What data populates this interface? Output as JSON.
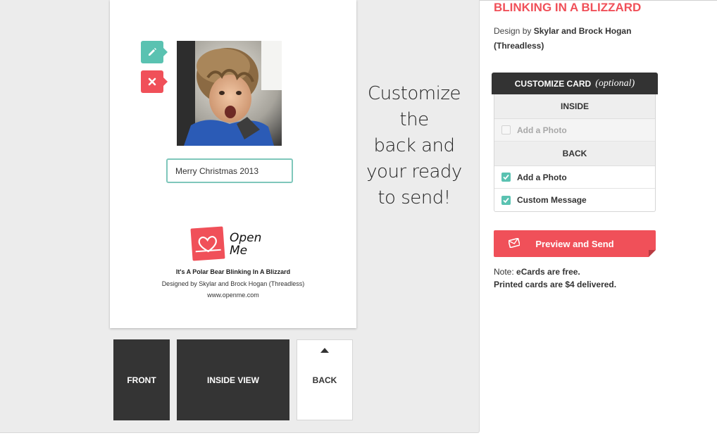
{
  "product": {
    "title": "BLINKING IN A BLIZZARD",
    "design_prefix": "Design by",
    "designer": "Skylar and Brock Hogan",
    "designer_org": "(Threadless)"
  },
  "card": {
    "message_value": "Merry Christmas 2013",
    "logo_line1": "Open",
    "logo_line2": "Me",
    "card_title": "It's A Polar Bear Blinking In A Blizzard",
    "card_designer": "Designed by Skylar and Brock Hogan (Threadless)",
    "card_url": "www.openme.com"
  },
  "handwriting": [
    "Customize the",
    "back and",
    "your ready",
    "to send!"
  ],
  "view_tabs": {
    "front": "FRONT",
    "inside": "INSIDE VIEW",
    "back": "BACK"
  },
  "customize": {
    "title": "CUSTOMIZE CARD",
    "title_note": "(optional)",
    "inside_section": "INSIDE",
    "inside_add_photo": "Add a Photo",
    "back_section": "BACK",
    "back_add_photo": "Add a Photo",
    "back_custom_message": "Custom Message"
  },
  "preview_button": "Preview and Send",
  "note": {
    "prefix": "Note:",
    "line1": "eCards are free.",
    "line2": "Printed cards are $4 delivered."
  },
  "colors": {
    "accent_red": "#f05059",
    "accent_teal": "#5ac2b1",
    "dark": "#343434"
  }
}
